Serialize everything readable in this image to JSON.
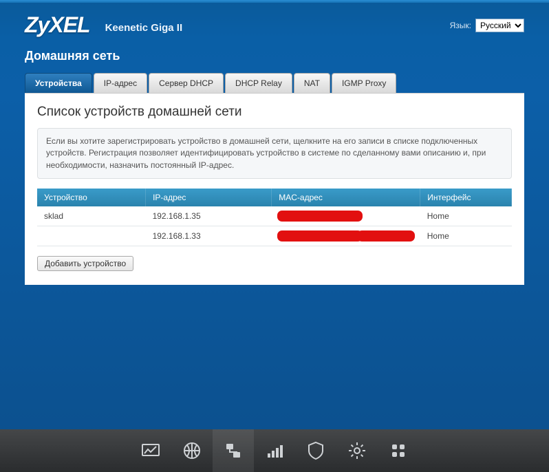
{
  "header": {
    "brand": "ZyXEL",
    "model": "Keenetic Giga II",
    "lang_label": "Язык:",
    "lang_options": [
      "Русский"
    ],
    "lang_value": "Русский"
  },
  "page": {
    "title": "Домашняя сеть"
  },
  "tabs": [
    {
      "label": "Устройства",
      "active": true
    },
    {
      "label": "IP-адрес"
    },
    {
      "label": "Сервер DHCP"
    },
    {
      "label": "DHCP Relay"
    },
    {
      "label": "NAT"
    },
    {
      "label": "IGMP Proxy"
    }
  ],
  "section": {
    "heading": "Список устройств домашней сети",
    "description": "Если вы хотите зарегистрировать устройство в домашней сети, щелкните на его записи в списке подключенных устройств. Регистрация позволяет идентифицировать устройство в системе по сделанному вами описанию и, при необходимости, назначить постоянный IP-адрес."
  },
  "table": {
    "headers": [
      "Устройство",
      "IP-адрес",
      "MAC-адрес",
      "Интерфейс"
    ],
    "rows": [
      {
        "device": "sklad",
        "ip": "192.168.1.35",
        "mac": "",
        "iface": "Home"
      },
      {
        "device": "",
        "ip": "192.168.1.33",
        "mac": "",
        "iface": "Home"
      }
    ]
  },
  "buttons": {
    "add_device": "Добавить устройство"
  },
  "bottom_nav": [
    {
      "name": "dashboard-icon"
    },
    {
      "name": "globe-icon"
    },
    {
      "name": "network-icon",
      "active": true
    },
    {
      "name": "signal-icon"
    },
    {
      "name": "shield-icon"
    },
    {
      "name": "gear-icon"
    },
    {
      "name": "apps-icon"
    }
  ]
}
